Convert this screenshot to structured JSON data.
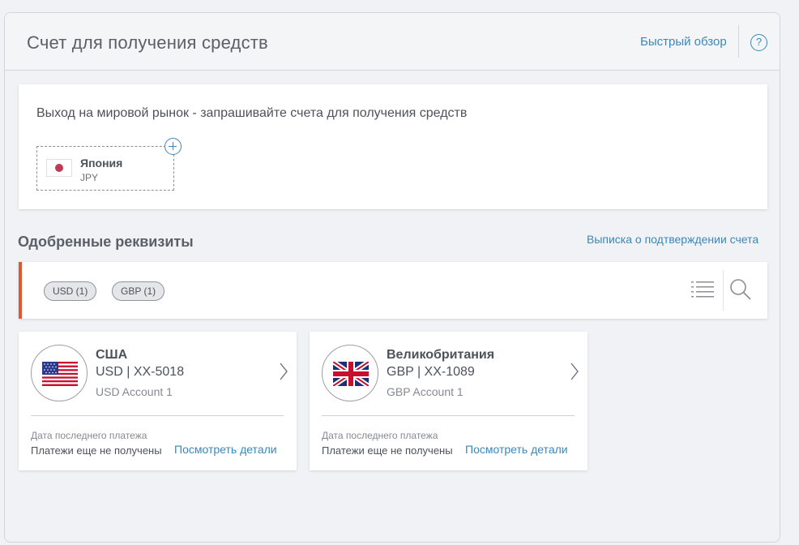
{
  "header": {
    "title": "Счет для получения средств",
    "quick_overview": "Быстрый обзор",
    "help": "?"
  },
  "market": {
    "prompt": "Выход на мировой рынок - запрашивайте счета для получения средств",
    "tiles": [
      {
        "country": "Япония",
        "currency": "JPY"
      }
    ]
  },
  "approved": {
    "title": "Одобренные реквизиты",
    "statement_link": "Выписка о подтверждении счета"
  },
  "filters": {
    "chips": [
      {
        "label": "USD (1)"
      },
      {
        "label": "GBP (1)"
      }
    ]
  },
  "accounts": [
    {
      "country": "США",
      "number": "USD | XX-5018",
      "name": "USD Account 1",
      "last_payment_label": "Дата последнего платежа",
      "last_payment_value": "Платежи еще не получены",
      "details_link": "Посмотреть детали",
      "flag": "us-flag-icon"
    },
    {
      "country": "Великобритания",
      "number": "GBP | XX-1089",
      "name": "GBP Account 1",
      "last_payment_label": "Дата последнего платежа",
      "last_payment_value": "Платежи еще не получены",
      "details_link": "Посмотреть детали",
      "flag": "uk-flag-icon"
    }
  ],
  "colors": {
    "accent": "#3c87b9",
    "filter_bar_marker": "#e8542b",
    "background": "#f1f2f5"
  }
}
